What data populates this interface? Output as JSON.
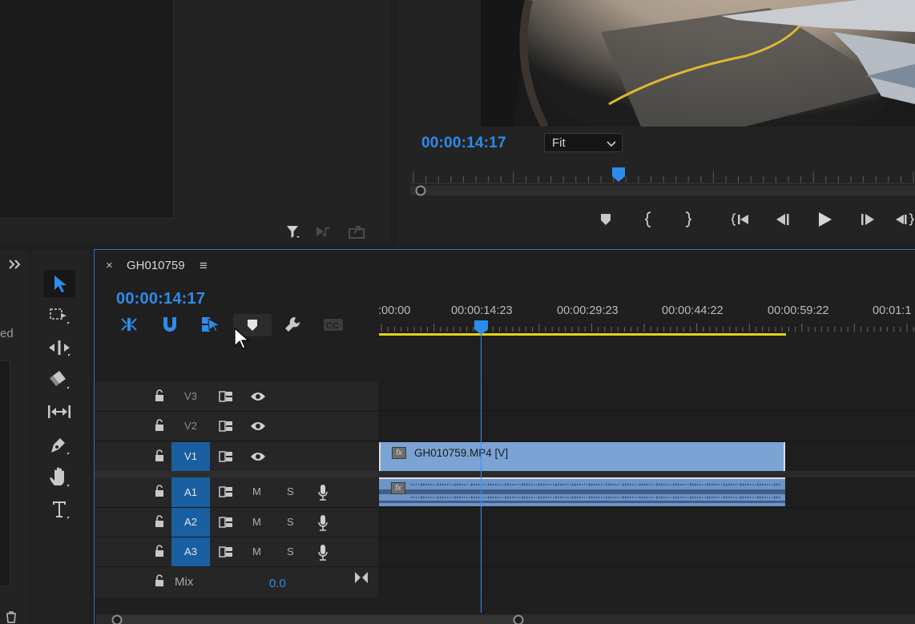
{
  "program_monitor": {
    "timecode": "00:00:14:17",
    "zoom_select": {
      "value": "Fit"
    }
  },
  "project_panel": {
    "partial_label": "ed"
  },
  "timeline": {
    "sequence_name": "GH010759",
    "close_glyph": "×",
    "menu_glyph": "≡",
    "timecode": "00:00:14:17",
    "ruler_labels": [
      ":00:00",
      "00:00:14:23",
      "00:00:29:23",
      "00:00:44:22",
      "00:00:59:22",
      "00:01:1"
    ],
    "tracks": [
      {
        "name": "V3",
        "targeted": false
      },
      {
        "name": "V2",
        "targeted": false
      },
      {
        "name": "V1",
        "targeted": true
      },
      {
        "name": "A1",
        "targeted": true
      },
      {
        "name": "A2",
        "targeted": true
      },
      {
        "name": "A3",
        "targeted": true
      }
    ],
    "audio_buttons": {
      "mute": "M",
      "solo": "S"
    },
    "mix": {
      "label": "Mix",
      "value": "0.0"
    },
    "clips": {
      "video": "GH010759.MP4 [V]",
      "fx_badge": "fx"
    }
  },
  "colors": {
    "accent_blue": "#2d8ceb",
    "track_target_blue": "#1a5fa0",
    "video_clip": "#7ba3d4",
    "audio_clip": "#6d95c7",
    "work_area_yellow": "#e3d21d",
    "panel_focus_border": "#2a6fc9"
  },
  "icons": [
    "filter-icon",
    "audio-out-icon",
    "export-icon",
    "add-marker-icon",
    "mark-in-icon",
    "mark-out-icon",
    "go-to-in-icon",
    "step-back-icon",
    "play-icon",
    "step-forward-icon",
    "go-to-out-icon",
    "selection-tool-icon",
    "track-select-tool-icon",
    "ripple-edit-tool-icon",
    "razor-tool-icon",
    "slip-tool-icon",
    "pen-tool-icon",
    "hand-tool-icon",
    "type-tool-icon",
    "nest-icon",
    "snap-icon",
    "linked-selection-icon",
    "marker-icon",
    "wrench-icon",
    "captions-icon",
    "lock-icon",
    "sync-lock-icon",
    "eye-icon",
    "mic-icon",
    "trash-icon"
  ]
}
